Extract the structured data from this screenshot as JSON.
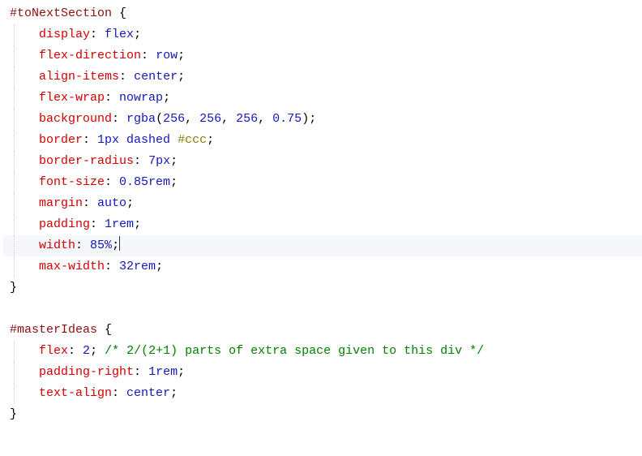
{
  "code": {
    "lines": [
      {
        "indent": 0,
        "current": false,
        "guide": false,
        "segments": [
          {
            "cls": "t-selector",
            "t": "#toNextSection"
          },
          {
            "cls": "t-punc",
            "t": " {"
          }
        ]
      },
      {
        "indent": 1,
        "current": false,
        "guide": true,
        "segments": [
          {
            "cls": "t-prop",
            "t": "display"
          },
          {
            "cls": "t-punc",
            "t": ": "
          },
          {
            "cls": "t-value",
            "t": "flex"
          },
          {
            "cls": "t-punc",
            "t": ";"
          }
        ]
      },
      {
        "indent": 1,
        "current": false,
        "guide": true,
        "segments": [
          {
            "cls": "t-prop",
            "t": "flex-direction"
          },
          {
            "cls": "t-punc",
            "t": ": "
          },
          {
            "cls": "t-value",
            "t": "row"
          },
          {
            "cls": "t-punc",
            "t": ";"
          }
        ]
      },
      {
        "indent": 1,
        "current": false,
        "guide": true,
        "segments": [
          {
            "cls": "t-prop",
            "t": "align-items"
          },
          {
            "cls": "t-punc",
            "t": ": "
          },
          {
            "cls": "t-value",
            "t": "center"
          },
          {
            "cls": "t-punc",
            "t": ";"
          }
        ]
      },
      {
        "indent": 1,
        "current": false,
        "guide": true,
        "segments": [
          {
            "cls": "t-prop",
            "t": "flex-wrap"
          },
          {
            "cls": "t-punc",
            "t": ": "
          },
          {
            "cls": "t-value",
            "t": "nowrap"
          },
          {
            "cls": "t-punc",
            "t": ";"
          }
        ]
      },
      {
        "indent": 1,
        "current": false,
        "guide": true,
        "segments": [
          {
            "cls": "t-prop",
            "t": "background"
          },
          {
            "cls": "t-punc",
            "t": ": "
          },
          {
            "cls": "t-value",
            "t": "rgba"
          },
          {
            "cls": "t-punc",
            "t": "("
          },
          {
            "cls": "t-value",
            "t": "256"
          },
          {
            "cls": "t-punc",
            "t": ", "
          },
          {
            "cls": "t-value",
            "t": "256"
          },
          {
            "cls": "t-punc",
            "t": ", "
          },
          {
            "cls": "t-value",
            "t": "256"
          },
          {
            "cls": "t-punc",
            "t": ", "
          },
          {
            "cls": "t-value",
            "t": "0.75"
          },
          {
            "cls": "t-punc",
            "t": ");"
          }
        ]
      },
      {
        "indent": 1,
        "current": false,
        "guide": true,
        "segments": [
          {
            "cls": "t-prop",
            "t": "border"
          },
          {
            "cls": "t-punc",
            "t": ": "
          },
          {
            "cls": "t-value",
            "t": "1px dashed "
          },
          {
            "cls": "t-hex",
            "t": "#ccc"
          },
          {
            "cls": "t-punc",
            "t": ";"
          }
        ]
      },
      {
        "indent": 1,
        "current": false,
        "guide": true,
        "segments": [
          {
            "cls": "t-prop",
            "t": "border-radius"
          },
          {
            "cls": "t-punc",
            "t": ": "
          },
          {
            "cls": "t-value",
            "t": "7px"
          },
          {
            "cls": "t-punc",
            "t": ";"
          }
        ]
      },
      {
        "indent": 1,
        "current": false,
        "guide": true,
        "segments": [
          {
            "cls": "t-prop",
            "t": "font-size"
          },
          {
            "cls": "t-punc",
            "t": ": "
          },
          {
            "cls": "t-value",
            "t": "0.85rem"
          },
          {
            "cls": "t-punc",
            "t": ";"
          }
        ]
      },
      {
        "indent": 1,
        "current": false,
        "guide": true,
        "segments": [
          {
            "cls": "t-prop",
            "t": "margin"
          },
          {
            "cls": "t-punc",
            "t": ": "
          },
          {
            "cls": "t-value",
            "t": "auto"
          },
          {
            "cls": "t-punc",
            "t": ";"
          }
        ]
      },
      {
        "indent": 1,
        "current": false,
        "guide": true,
        "segments": [
          {
            "cls": "t-prop",
            "t": "padding"
          },
          {
            "cls": "t-punc",
            "t": ": "
          },
          {
            "cls": "t-value",
            "t": "1rem"
          },
          {
            "cls": "t-punc",
            "t": ";"
          }
        ]
      },
      {
        "indent": 1,
        "current": true,
        "guide": true,
        "cursorAfter": true,
        "segments": [
          {
            "cls": "t-prop",
            "t": "width"
          },
          {
            "cls": "t-punc",
            "t": ": "
          },
          {
            "cls": "t-value",
            "t": "85%"
          },
          {
            "cls": "t-punc",
            "t": ";"
          }
        ]
      },
      {
        "indent": 1,
        "current": false,
        "guide": true,
        "segments": [
          {
            "cls": "t-prop",
            "t": "max-width"
          },
          {
            "cls": "t-punc",
            "t": ": "
          },
          {
            "cls": "t-value",
            "t": "32rem"
          },
          {
            "cls": "t-punc",
            "t": ";"
          }
        ]
      },
      {
        "indent": 0,
        "current": false,
        "guide": false,
        "segments": [
          {
            "cls": "t-punc",
            "t": "}"
          }
        ]
      },
      {
        "indent": 0,
        "current": false,
        "guide": false,
        "blank": true,
        "segments": []
      },
      {
        "indent": 0,
        "current": false,
        "guide": false,
        "segments": [
          {
            "cls": "t-selector",
            "t": "#masterIdeas"
          },
          {
            "cls": "t-punc",
            "t": " {"
          }
        ]
      },
      {
        "indent": 1,
        "current": false,
        "guide": true,
        "segments": [
          {
            "cls": "t-prop",
            "t": "flex"
          },
          {
            "cls": "t-punc",
            "t": ": "
          },
          {
            "cls": "t-value",
            "t": "2"
          },
          {
            "cls": "t-punc",
            "t": "; "
          },
          {
            "cls": "t-comment",
            "t": "/* 2/(2+1) parts of extra space given to this div */"
          }
        ]
      },
      {
        "indent": 1,
        "current": false,
        "guide": true,
        "segments": [
          {
            "cls": "t-prop",
            "t": "padding-right"
          },
          {
            "cls": "t-punc",
            "t": ": "
          },
          {
            "cls": "t-value",
            "t": "1rem"
          },
          {
            "cls": "t-punc",
            "t": ";"
          }
        ]
      },
      {
        "indent": 1,
        "current": false,
        "guide": true,
        "segments": [
          {
            "cls": "t-prop",
            "t": "text-align"
          },
          {
            "cls": "t-punc",
            "t": ": "
          },
          {
            "cls": "t-value",
            "t": "center"
          },
          {
            "cls": "t-punc",
            "t": ";"
          }
        ]
      },
      {
        "indent": 0,
        "current": false,
        "guide": false,
        "segments": [
          {
            "cls": "t-punc",
            "t": "}"
          }
        ]
      }
    ]
  },
  "indentString": "    "
}
